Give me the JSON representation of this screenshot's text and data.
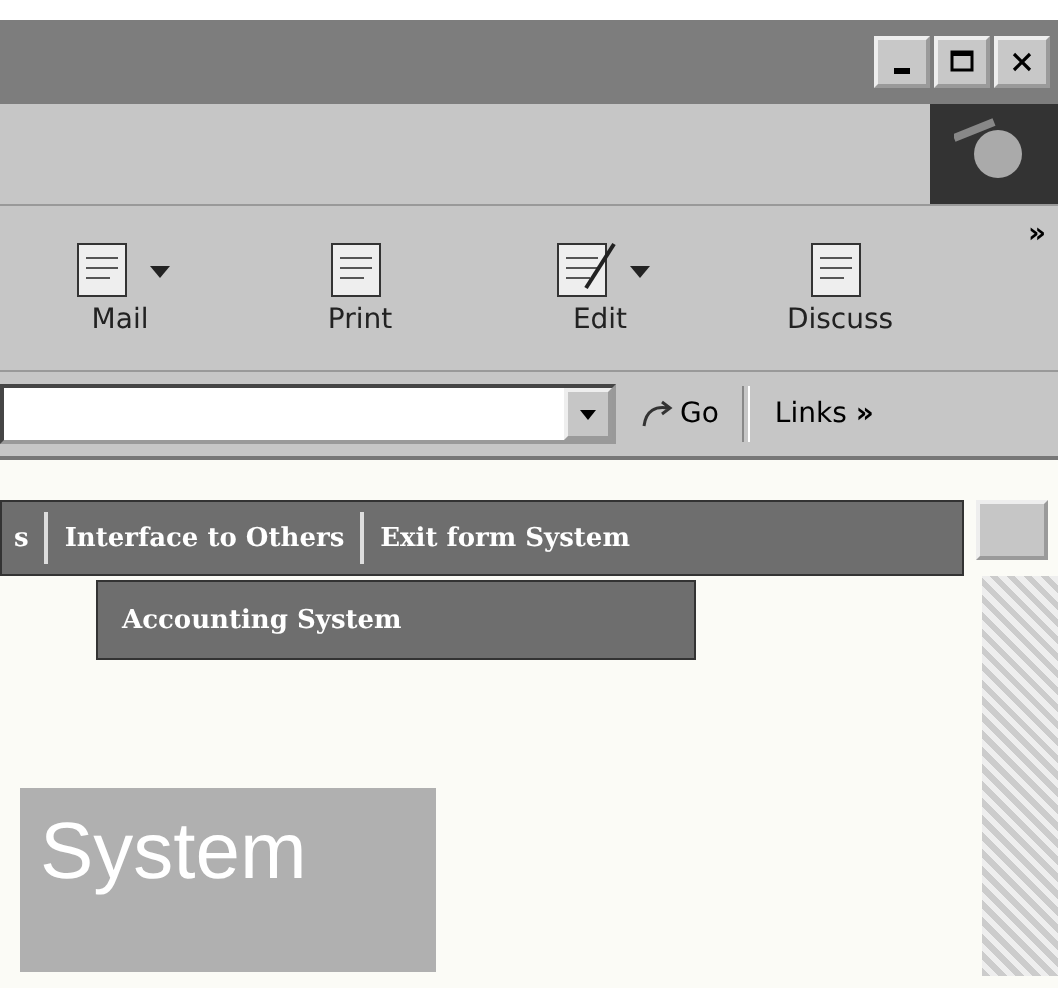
{
  "window": {
    "controls": [
      {
        "kind": "minimize"
      },
      {
        "kind": "maximize"
      },
      {
        "kind": "close"
      }
    ]
  },
  "toolbar": {
    "buttons": [
      {
        "label": "Mail",
        "dropdown": true
      },
      {
        "label": "Print",
        "dropdown": false
      },
      {
        "label": "Edit",
        "dropdown": true
      },
      {
        "label": "Discuss",
        "dropdown": false
      }
    ],
    "overflow": "»"
  },
  "address_bar": {
    "go": "Go",
    "links": "Links",
    "links_overflow": "»"
  },
  "page": {
    "nav_items": [
      "s",
      "Interface to Others",
      "Exit form System"
    ],
    "submenu": [
      "Accounting System"
    ],
    "banner": "System"
  }
}
